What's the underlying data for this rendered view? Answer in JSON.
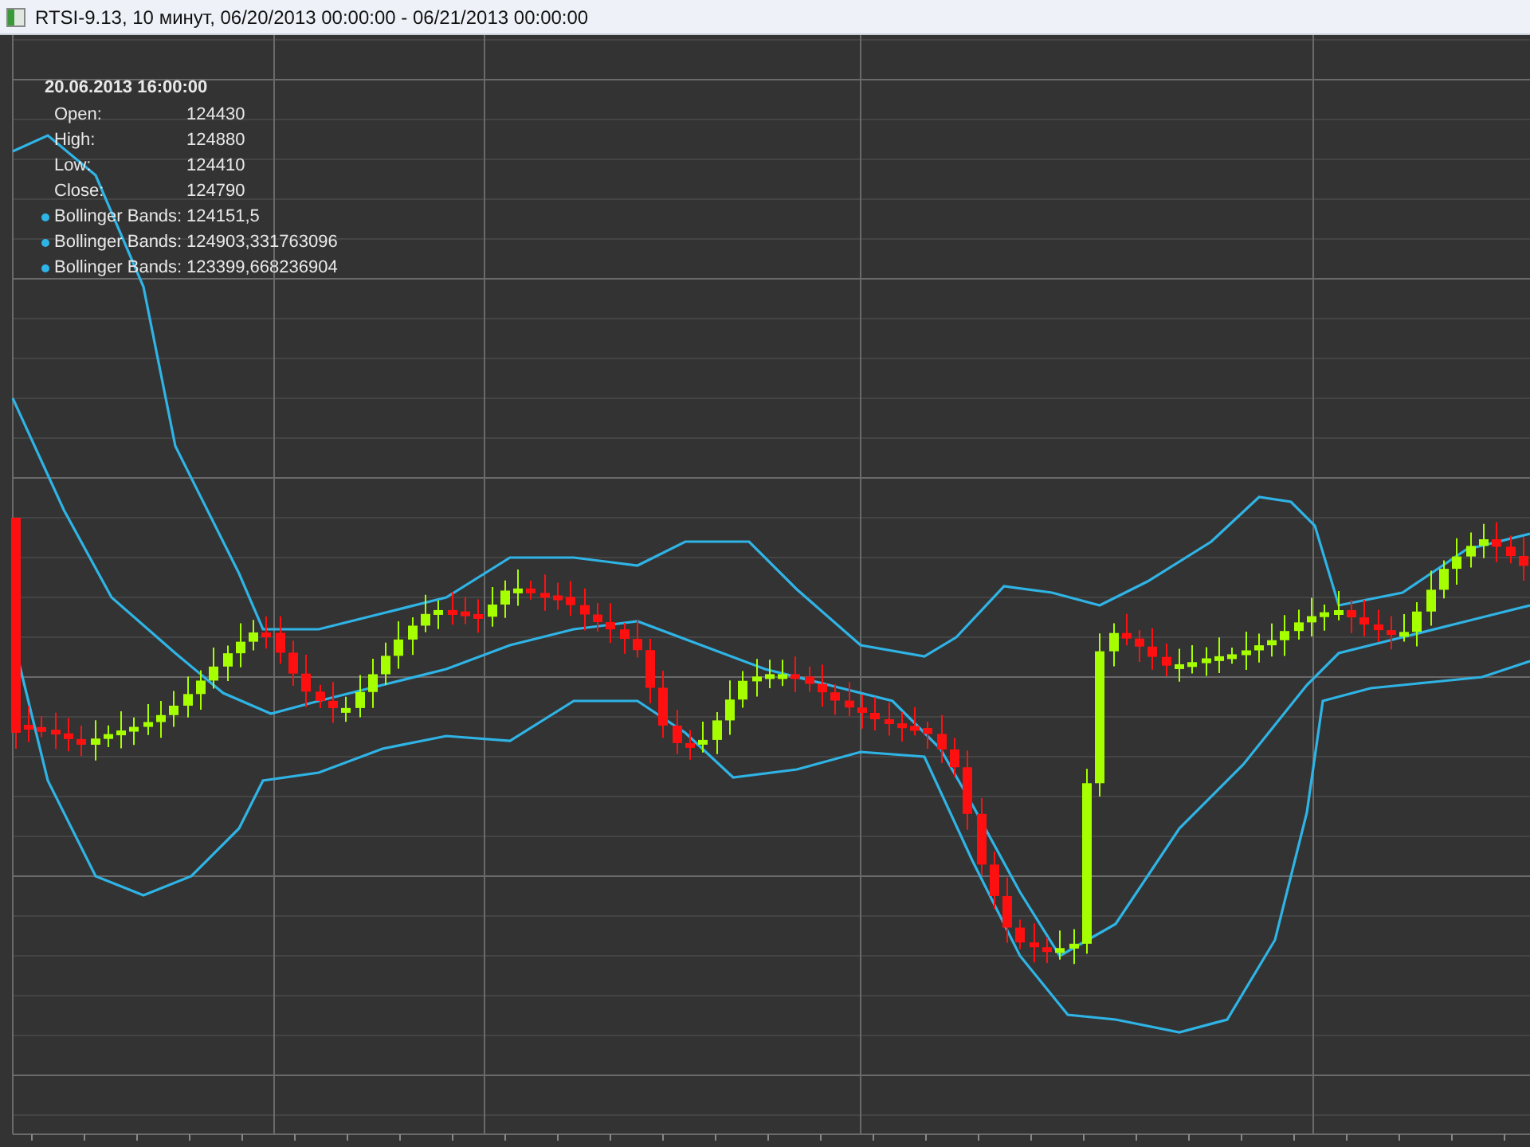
{
  "window": {
    "title": "RTSI-9.13, 10 минут, 06/20/2013 00:00:00 - 06/21/2013 00:00:00"
  },
  "legend": {
    "timestamp": "20.06.2013 16:00:00",
    "rows": [
      {
        "kind": "price",
        "label": "Open:",
        "value": "124430"
      },
      {
        "kind": "price",
        "label": "High:",
        "value": "124880"
      },
      {
        "kind": "price",
        "label": "Low:",
        "value": "124410"
      },
      {
        "kind": "price",
        "label": "Close:",
        "value": "124790"
      },
      {
        "kind": "indicator",
        "label": "Bollinger Bands:",
        "value": "124151,5"
      },
      {
        "kind": "indicator",
        "label": "Bollinger Bands:",
        "value": "124903,331763096"
      },
      {
        "kind": "indicator",
        "label": "Bollinger Bands:",
        "value": "123399,668236904"
      }
    ]
  }
}
